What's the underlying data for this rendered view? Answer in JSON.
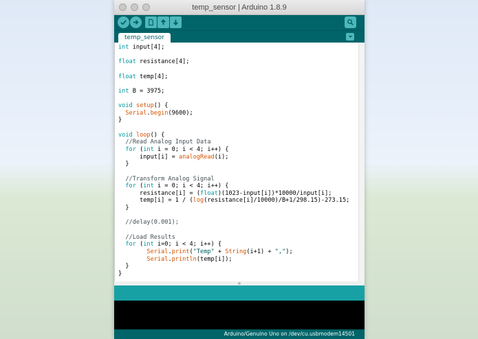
{
  "window": {
    "title": "temp_sensor | Arduino 1.8.9"
  },
  "toolbar": {
    "buttons": [
      {
        "name": "verify",
        "icon": "checkmark-icon"
      },
      {
        "name": "upload",
        "icon": "arrow-right-icon"
      },
      {
        "name": "new",
        "icon": "new-file-icon"
      },
      {
        "name": "open",
        "icon": "arrow-up-icon"
      },
      {
        "name": "save",
        "icon": "arrow-down-icon"
      }
    ],
    "serial_monitor_icon": "magnifier-icon"
  },
  "tabs": [
    {
      "label": "temp_sensor",
      "active": true
    }
  ],
  "code_lines": [
    "int input[4];",
    "",
    "float resistance[4];",
    "",
    "float temp[4];",
    "",
    "int B = 3975;",
    "",
    "void setup() {",
    "  Serial.begin(9600);",
    "}",
    "",
    "void loop() {",
    "  //Read Analog Input Data",
    "  for (int i = 0; i < 4; i++) {",
    "      input[i] = analogRead(i);",
    "  }",
    "",
    "  //Transform Analog Signal",
    "  for (int i = 0; i < 4; i++) {",
    "      resistance[i] = (float)(1023-input[i])*10000/input[i];",
    "      temp[i] = 1 / (log(resistance[i]/10000)/B+1/298.15)-273.15;",
    "  }",
    "",
    "  //delay(0.001);",
    "",
    "  //Load Results",
    "  for (int i=0; i < 4; i++) {",
    "        Serial.print(\"Temp\" + String(i+1) + \",\");",
    "        Serial.println(temp[i]);",
    "  }",
    "}"
  ],
  "status": {
    "board_port": "Arduino/Genuino Uno on /dev/cu.usbmodem14501"
  },
  "colors": {
    "toolbar": "#006468",
    "button": "#4db7bb",
    "message_bar": "#17a1a5",
    "keyword": "#00979c",
    "function": "#d35400",
    "console": "#000000"
  }
}
